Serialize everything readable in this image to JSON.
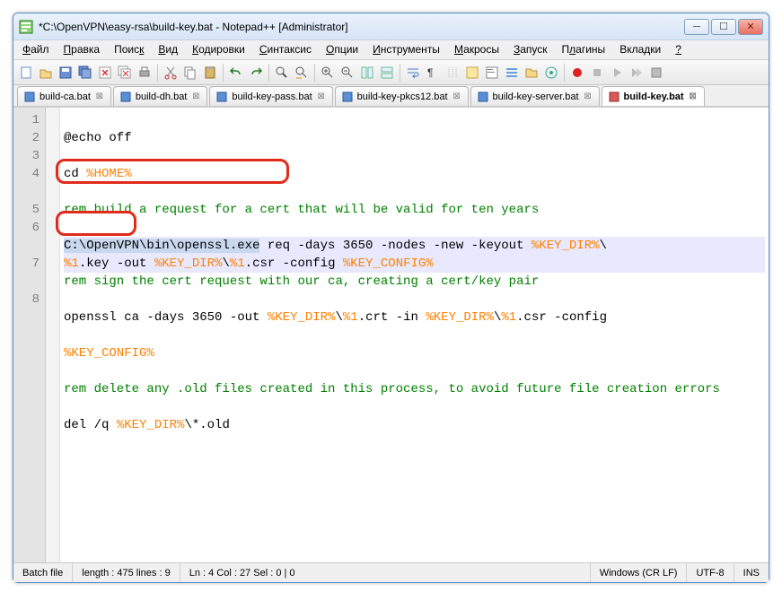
{
  "window": {
    "title": "*C:\\OpenVPN\\easy-rsa\\build-key.bat - Notepad++ [Administrator]"
  },
  "menu": [
    "Файл",
    "Правка",
    "Поиск",
    "Вид",
    "Кодировки",
    "Синтаксис",
    "Опции",
    "Инструменты",
    "Макросы",
    "Запуск",
    "Плагины",
    "Вкладки",
    "?"
  ],
  "tabs": [
    {
      "label": "build-ca.bat",
      "active": false
    },
    {
      "label": "build-dh.bat",
      "active": false
    },
    {
      "label": "build-key-pass.bat",
      "active": false
    },
    {
      "label": "build-key-pkcs12.bat",
      "active": false
    },
    {
      "label": "build-key-server.bat",
      "active": false
    },
    {
      "label": "build-key.bat",
      "active": true
    }
  ],
  "code": {
    "line_numbers": [
      "1",
      "2",
      "3",
      "4",
      "5",
      "6",
      "7",
      "8"
    ],
    "l1": "@echo off",
    "l2a": "cd ",
    "l2b": "%HOME%",
    "l3": "rem build a request for a cert that will be valid for ten years",
    "l4sel": "C:\\OpenVPN\\bin\\openssl.exe",
    "l4a": " req -days 3650 -nodes -new -keyout ",
    "l4v1": "%KEY_DIR%",
    "l4b": "\\",
    "l4v2": "%1",
    "l4c": ".key -out ",
    "l4v3": "%KEY_DIR%",
    "l4d": "\\",
    "l4v4": "%1",
    "l4e": ".csr -config ",
    "l4v5": "%KEY_CONFIG%",
    "l5": "rem sign the cert request with our ca, creating a cert/key pair",
    "l6a": "openssl",
    "l6b": " ca -days 3650 -out ",
    "l6v1": "%KEY_DIR%",
    "l6c": "\\",
    "l6v2": "%1",
    "l6d": ".crt -in ",
    "l6v3": "%KEY_DIR%",
    "l6e": "\\",
    "l6v4": "%1",
    "l6f": ".csr -config ",
    "l6v5": "%KEY_CONFIG%",
    "l7": "rem delete any .old files created in this process, to avoid future file creation errors",
    "l8a": "del /q ",
    "l8v1": "%KEY_DIR%",
    "l8b": "\\*.old"
  },
  "status": {
    "type": "Batch file",
    "length": "length : 475    lines : 9",
    "pos": "Ln : 4    Col : 27    Sel : 0 | 0",
    "eol": "Windows (CR LF)",
    "enc": "UTF-8",
    "mode": "INS"
  }
}
